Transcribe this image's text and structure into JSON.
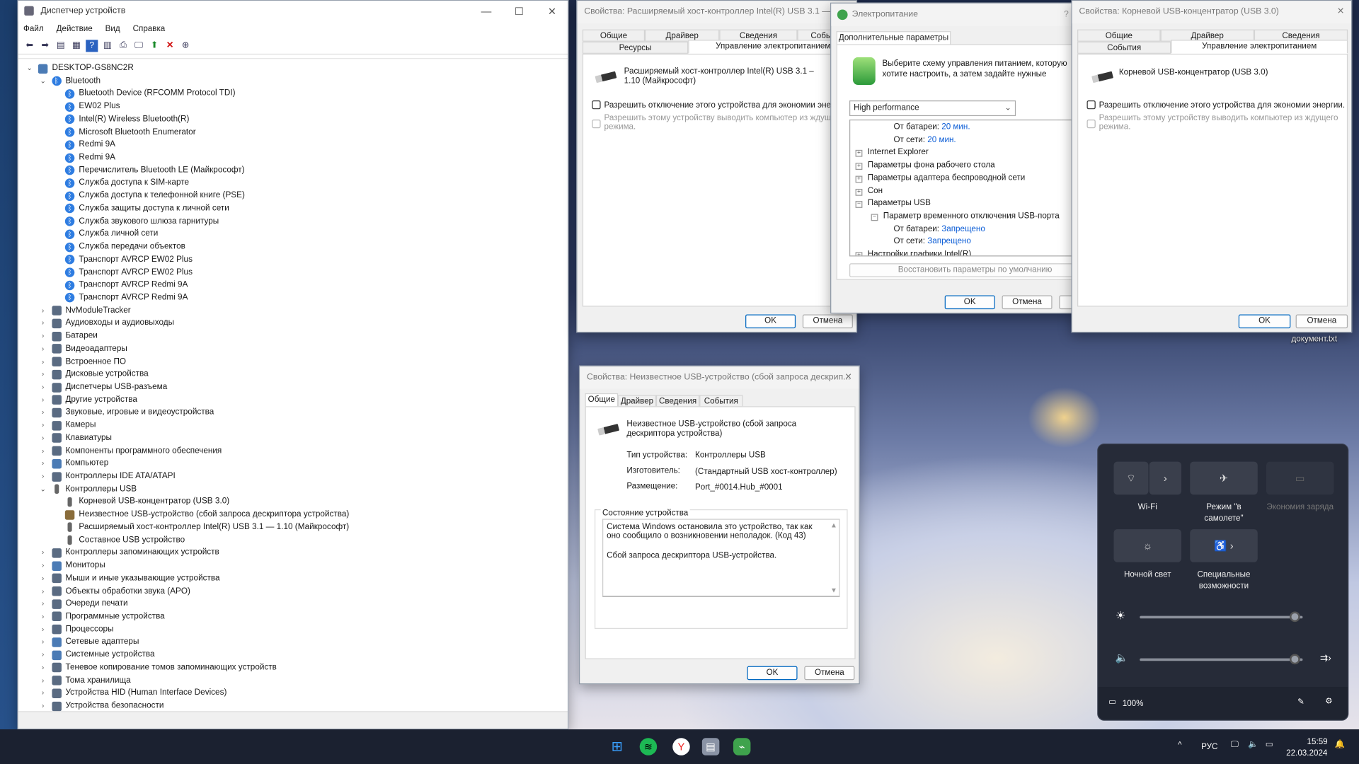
{
  "desktop": {
    "file_label": "документ.txt"
  },
  "device_manager": {
    "title": "Диспетчер устройств",
    "menu": [
      "Файл",
      "Действие",
      "Вид",
      "Справка"
    ],
    "tree": [
      {
        "level": 0,
        "label": "DESKTOP-GS8NC2R",
        "expanded": true,
        "icon": "computer"
      },
      {
        "level": 1,
        "label": "Bluetooth",
        "expanded": true,
        "icon": "bluetooth"
      },
      {
        "level": 2,
        "label": "Bluetooth Device (RFCOMM Protocol TDI)",
        "icon": "bluetooth"
      },
      {
        "level": 2,
        "label": "EW02 Plus",
        "icon": "bluetooth"
      },
      {
        "level": 2,
        "label": "Intel(R) Wireless Bluetooth(R)",
        "icon": "bluetooth"
      },
      {
        "level": 2,
        "label": "Microsoft Bluetooth Enumerator",
        "icon": "bluetooth"
      },
      {
        "level": 2,
        "label": "Redmi 9A",
        "icon": "bluetooth"
      },
      {
        "level": 2,
        "label": "Redmi 9A",
        "icon": "bluetooth"
      },
      {
        "level": 2,
        "label": "Перечислитель Bluetooth LE (Майкрософт)",
        "icon": "bluetooth"
      },
      {
        "level": 2,
        "label": "Служба доступа к SIM-карте",
        "icon": "bluetooth"
      },
      {
        "level": 2,
        "label": "Служба доступа к телефонной книге (PSE)",
        "icon": "bluetooth"
      },
      {
        "level": 2,
        "label": "Служба защиты доступа к личной сети",
        "icon": "bluetooth"
      },
      {
        "level": 2,
        "label": "Служба звукового шлюза гарнитуры",
        "icon": "bluetooth"
      },
      {
        "level": 2,
        "label": "Служба личной сети",
        "icon": "bluetooth"
      },
      {
        "level": 2,
        "label": "Служба передачи объектов",
        "icon": "bluetooth"
      },
      {
        "level": 2,
        "label": "Транспорт AVRCP EW02 Plus",
        "icon": "bluetooth"
      },
      {
        "level": 2,
        "label": "Транспорт AVRCP EW02 Plus",
        "icon": "bluetooth"
      },
      {
        "level": 2,
        "label": "Транспорт AVRCP Redmi 9A",
        "icon": "bluetooth"
      },
      {
        "level": 2,
        "label": "Транспорт AVRCP Redmi 9A",
        "icon": "bluetooth"
      },
      {
        "level": 1,
        "label": "NvModuleTracker",
        "expanded": false,
        "icon": "category"
      },
      {
        "level": 1,
        "label": "Аудиовходы и аудиовыходы",
        "expanded": false,
        "icon": "category"
      },
      {
        "level": 1,
        "label": "Батареи",
        "expanded": false,
        "icon": "category"
      },
      {
        "level": 1,
        "label": "Видеоадаптеры",
        "expanded": false,
        "icon": "category"
      },
      {
        "level": 1,
        "label": "Встроенное ПО",
        "expanded": false,
        "icon": "category"
      },
      {
        "level": 1,
        "label": "Дисковые устройства",
        "expanded": false,
        "icon": "category"
      },
      {
        "level": 1,
        "label": "Диспетчеры USB-разъема",
        "expanded": false,
        "icon": "category"
      },
      {
        "level": 1,
        "label": "Другие устройства",
        "expanded": false,
        "icon": "category"
      },
      {
        "level": 1,
        "label": "Звуковые, игровые и видеоустройства",
        "expanded": false,
        "icon": "category"
      },
      {
        "level": 1,
        "label": "Камеры",
        "expanded": false,
        "icon": "category"
      },
      {
        "level": 1,
        "label": "Клавиатуры",
        "expanded": false,
        "icon": "category"
      },
      {
        "level": 1,
        "label": "Компоненты программного обеспечения",
        "expanded": false,
        "icon": "category"
      },
      {
        "level": 1,
        "label": "Компьютер",
        "expanded": false,
        "icon": "computer"
      },
      {
        "level": 1,
        "label": "Контроллеры IDE ATA/ATAPI",
        "expanded": false,
        "icon": "category"
      },
      {
        "level": 1,
        "label": "Контроллеры USB",
        "expanded": true,
        "icon": "usb"
      },
      {
        "level": 2,
        "label": "Корневой USB-концентратор (USB 3.0)",
        "icon": "usb"
      },
      {
        "level": 2,
        "label": "Неизвестное USB-устройство (сбой запроса дескриптора устройства)",
        "icon": "warning"
      },
      {
        "level": 2,
        "label": "Расширяемый хост-контроллер Intel(R) USB 3.1 — 1.10 (Майкрософт)",
        "icon": "usb"
      },
      {
        "level": 2,
        "label": "Составное USB устройство",
        "icon": "usb"
      },
      {
        "level": 1,
        "label": "Контроллеры запоминающих устройств",
        "expanded": false,
        "icon": "category"
      },
      {
        "level": 1,
        "label": "Мониторы",
        "expanded": false,
        "icon": "computer"
      },
      {
        "level": 1,
        "label": "Мыши и иные указывающие устройства",
        "expanded": false,
        "icon": "category"
      },
      {
        "level": 1,
        "label": "Объекты обработки звука (APO)",
        "expanded": false,
        "icon": "category"
      },
      {
        "level": 1,
        "label": "Очереди печати",
        "expanded": false,
        "icon": "category"
      },
      {
        "level": 1,
        "label": "Программные устройства",
        "expanded": false,
        "icon": "category"
      },
      {
        "level": 1,
        "label": "Процессоры",
        "expanded": false,
        "icon": "category"
      },
      {
        "level": 1,
        "label": "Сетевые адаптеры",
        "expanded": false,
        "icon": "computer"
      },
      {
        "level": 1,
        "label": "Системные устройства",
        "expanded": false,
        "icon": "computer"
      },
      {
        "level": 1,
        "label": "Теневое копирование томов запоминающих устройств",
        "expanded": false,
        "icon": "category"
      },
      {
        "level": 1,
        "label": "Тома хранилища",
        "expanded": false,
        "icon": "category"
      },
      {
        "level": 1,
        "label": "Устройства HID (Human Interface Devices)",
        "expanded": false,
        "icon": "category"
      },
      {
        "level": 1,
        "label": "Устройства безопасности",
        "expanded": false,
        "icon": "category"
      }
    ]
  },
  "host_dialog": {
    "title": "Свойства: Расширяемый хост-контроллер Intel(R) USB 3.1 — 1...",
    "tabs_row1": [
      "Общие",
      "Драйвер",
      "Сведения",
      "События"
    ],
    "tabs_row2": [
      "Ресурсы",
      "Управление электропитанием"
    ],
    "device_name": "Расширяемый хост-контроллер Intel(R) USB 3.1 – 1.10 (Майкрософт)",
    "allow_off": "Разрешить отключение этого устройства для экономии энергии",
    "allow_wake": "Разрешить этому устройству выводить компьютер из ждущего режима.",
    "ok": "OK",
    "cancel": "Отмена"
  },
  "power_dialog": {
    "title": "Электропитание",
    "tab": "Дополнительные параметры",
    "description": "Выберите схему управления питанием, которую хотите настроить, а затем задайте нужные параметры",
    "scheme": "High performance",
    "tree": [
      {
        "label": "От батареи:",
        "value": "20 мин.",
        "level": 2
      },
      {
        "label": "От сети:",
        "value": "20 мин.",
        "level": 2
      },
      {
        "label": "Internet Explorer",
        "level": 0,
        "sign": "+"
      },
      {
        "label": "Параметры фона рабочего стола",
        "level": 0,
        "sign": "+"
      },
      {
        "label": "Параметры адаптера беспроводной сети",
        "level": 0,
        "sign": "+"
      },
      {
        "label": "Сон",
        "level": 0,
        "sign": "+"
      },
      {
        "label": "Параметры USB",
        "level": 0,
        "sign": "−"
      },
      {
        "label": "Параметр временного отключения USB-порта",
        "level": 1,
        "sign": "−"
      },
      {
        "label": "От батареи:",
        "value": "Запрещено",
        "level": 2
      },
      {
        "label": "От сети:",
        "value": "Запрещено",
        "level": 2
      },
      {
        "label": "Настройки графики Intel(R)",
        "level": 0,
        "sign": "+"
      }
    ],
    "restore": "Восстановить параметры по умолчанию",
    "ok": "OK",
    "cancel": "Отмена",
    "apply": "П"
  },
  "hub_dialog": {
    "title": "Свойства: Корневой USB-концентратор (USB 3.0)",
    "tabs_row1": [
      "Общие",
      "Драйвер",
      "Сведения"
    ],
    "tabs_row2": [
      "События",
      "Управление электропитанием"
    ],
    "device_name": "Корневой USB-концентратор (USB 3.0)",
    "allow_off": "Разрешить отключение этого устройства для экономии энергии.",
    "allow_wake": "Разрешить этому устройству выводить компьютер из ждущего режима.",
    "ok": "OK",
    "cancel": "Отмена"
  },
  "unknown_dialog": {
    "title": "Свойства: Неизвестное USB-устройство (сбой запроса дескрип...",
    "tabs": [
      "Общие",
      "Драйвер",
      "Сведения",
      "События"
    ],
    "device_name": "Неизвестное USB-устройство (сбой запроса дескриптора устройства)",
    "props": [
      {
        "label": "Тип устройства:",
        "value": "Контроллеры USB"
      },
      {
        "label": "Изготовитель:",
        "value": "(Стандартный USB хост-контроллер)"
      },
      {
        "label": "Размещение:",
        "value": "Port_#0014.Hub_#0001"
      }
    ],
    "status_group": "Состояние устройства",
    "status_line1": "Система Windows остановила это устройство, так как оно сообщило о возникновении неполадок. (Код 43)",
    "status_line2": "Сбой запроса дескриптора USB-устройства.",
    "ok": "OK",
    "cancel": "Отмена"
  },
  "quick_settings": {
    "wifi": "Wi-Fi",
    "airplane": "Режим \"в самолете\"",
    "battery_saver": "Экономия заряда",
    "night_light": "Ночной свет",
    "accessibility": "Специальные возможности",
    "brightness": 0.95,
    "volume": 0.95,
    "battery": "100%"
  },
  "taskbar": {
    "apps": [
      "windows-start",
      "spotify",
      "yandex-browser",
      "device-manager",
      "power-options"
    ],
    "lang": "РУС",
    "time": "15:59",
    "date": "22.03.2024"
  }
}
